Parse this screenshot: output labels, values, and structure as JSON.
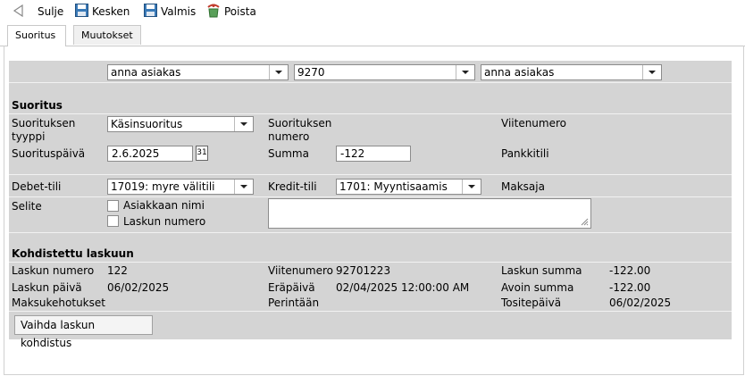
{
  "toolbar": {
    "close_label": "Sulje",
    "draft_label": "Kesken",
    "done_label": "Valmis",
    "delete_label": "Poista"
  },
  "tabs": [
    {
      "label": "Suoritus"
    },
    {
      "label": "Muutokset"
    }
  ],
  "top_row": {
    "customer_select": "anna asiakas",
    "number_select": "9270",
    "payer_select": "anna asiakas"
  },
  "suoritus": {
    "heading": "Suoritus",
    "type_label": "Suorituksen tyyppi",
    "type_value": "Käsinsuoritus",
    "number_label": "Suorituksen numero",
    "reference_label": "Viitenumero",
    "date_label": "Suorituspäivä",
    "date_value": "2.6.2025",
    "calendar_day": "31",
    "amount_label": "Summa",
    "amount_value": "-122",
    "bank_label": "Pankkitili",
    "debit_label": "Debet-tili",
    "debit_value": "17019: myre välitili",
    "credit_label": "Kredit-tili",
    "credit_value": "1701: Myyntisaamis",
    "payer_label": "Maksaja",
    "note_label": "Selite",
    "check_customer_name": "Asiakkaan nimi",
    "check_invoice_number": "Laskun numero"
  },
  "kohdistettu": {
    "heading": "Kohdistettu laskuun",
    "invoice_number_label": "Laskun numero",
    "invoice_number_value": "122",
    "reference_label": "Viitenumero",
    "reference_value": "92701223",
    "invoice_sum_label": "Laskun summa",
    "invoice_sum_value": "-122.00",
    "invoice_date_label": "Laskun päivä",
    "invoice_date_value": "06/02/2025",
    "due_date_label": "Eräpäivä",
    "due_date_value": "02/04/2025 12:00:00 AM",
    "open_sum_label": "Avoin summa",
    "open_sum_value": "-122.00",
    "reminders_label": "Maksukehotukset",
    "collection_label": "Perintään",
    "voucher_date_label": "Tositepäivä",
    "voucher_date_value": "06/02/2025",
    "change_button": "Vaihda laskun kohdistus"
  },
  "colors": {
    "panel": "#d4d4d4",
    "save_icon": "#3a7ab8",
    "delete_icon": "#c0392b"
  }
}
